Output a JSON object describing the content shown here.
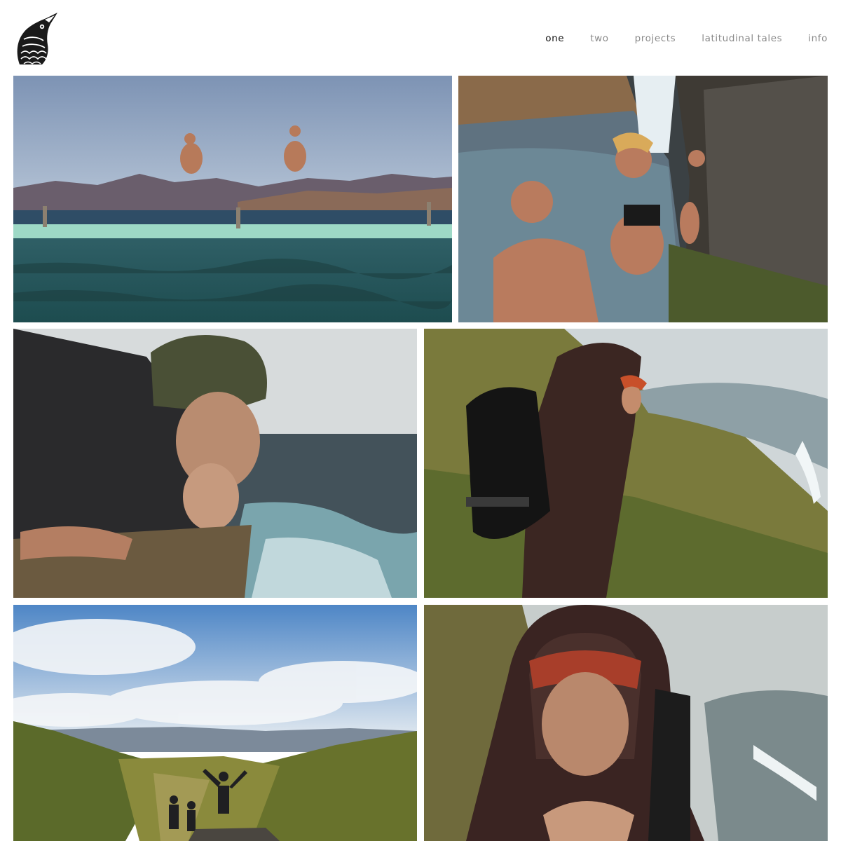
{
  "logo": {
    "icon": "bird-head-logo-icon"
  },
  "nav": {
    "items": [
      {
        "label": "one",
        "active": true
      },
      {
        "label": "two",
        "active": false
      },
      {
        "label": "projects",
        "active": false
      },
      {
        "label": "latitudinal tales",
        "active": false
      },
      {
        "label": "info",
        "active": false
      }
    ]
  },
  "gallery": {
    "photos": [
      {
        "subject": "two men diving into an ocean pool with mountains"
      },
      {
        "subject": "swimmers by a waterfall pool"
      },
      {
        "subject": "man and woman peering over a sea cliff"
      },
      {
        "subject": "hiker with backpack in the rain on a hillside"
      },
      {
        "subject": "hikers celebrating above a green valley"
      },
      {
        "subject": "woman in a wet hood on a hillside"
      }
    ]
  }
}
